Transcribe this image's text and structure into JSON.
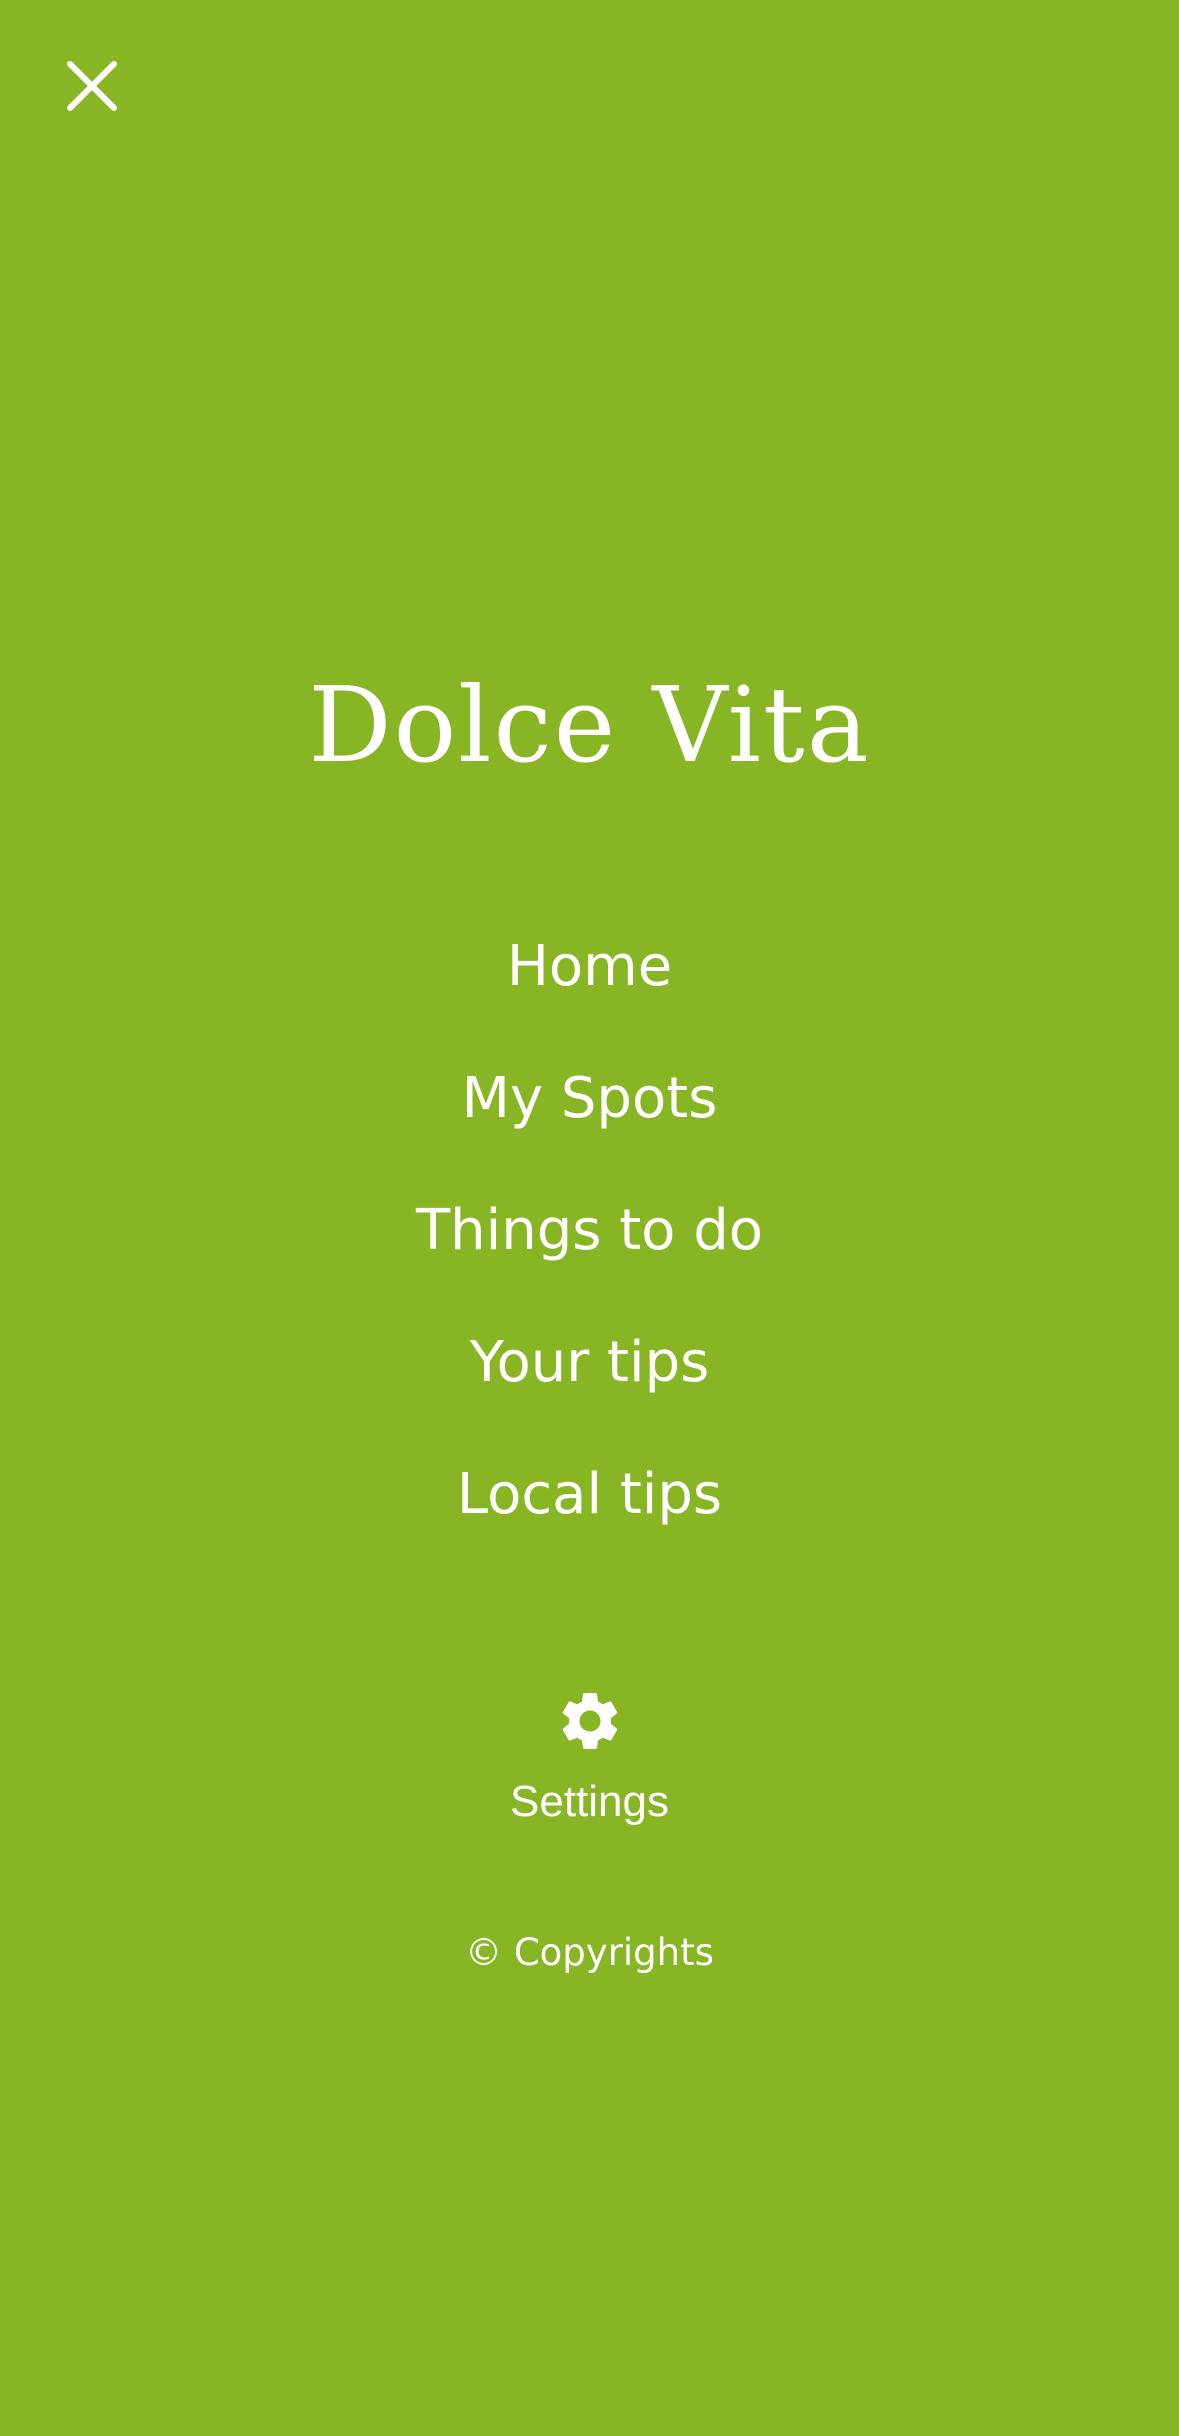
{
  "close_icon": "close-icon",
  "brand": {
    "title": "Dolce Vita"
  },
  "menu": {
    "items": [
      {
        "label": "Home"
      },
      {
        "label": "My Spots"
      },
      {
        "label": "Things to do"
      },
      {
        "label": "Your tips"
      },
      {
        "label": "Local tips"
      }
    ]
  },
  "settings": {
    "icon": "gear-icon",
    "label": "Settings"
  },
  "footer": {
    "copyright": "© Copyrights"
  },
  "colors": {
    "background": "#88b523",
    "foreground": "#ffffff"
  }
}
